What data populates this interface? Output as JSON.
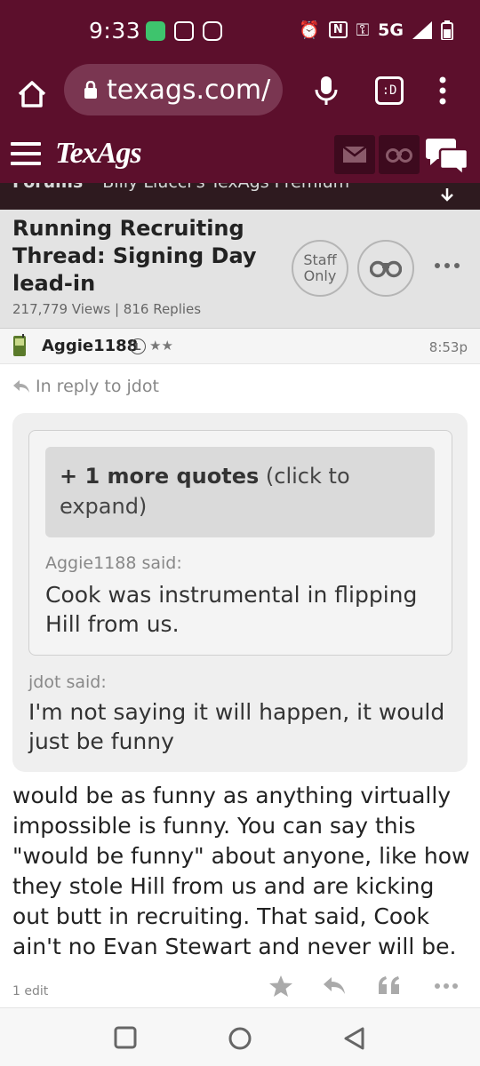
{
  "status_bar": {
    "time": "9:33",
    "network": "5G"
  },
  "browser": {
    "url": "texags.com/",
    "tab_label": ":D"
  },
  "site": {
    "logo": "TexAgs"
  },
  "breadcrumb": {
    "section": "Forums",
    "board": "Billy Liucci's TexAgs Premium"
  },
  "thread": {
    "title": "Running Recruiting Thread: Signing Day lead-in",
    "stats": "217,779 Views | 816 Replies",
    "staff_label_1": "Staff",
    "staff_label_2": "Only"
  },
  "post": {
    "author": "Aggie1188",
    "badge": "L",
    "stars": "★★",
    "time": "8:53p",
    "reply_to": "In reply to jdot",
    "more_quotes_bold": "+ 1 more quotes",
    "more_quotes_rest": " (click to expand)",
    "inner_said": "Aggie1188 said:",
    "inner_quote": "Cook was instrumental in flipping Hill from us.",
    "outer_said": "jdot said:",
    "outer_quote": "I'm not saying it will happen, it would just be funny",
    "body": "would be as funny as anything virtually impossible is funny. You can say this \"would be funny\" about anyone, like how they stole Hill from us and are kicking out butt in recruiting. That said, Cook ain't no Evan Stewart and never will be.",
    "edit_label": "1 edit"
  },
  "colors": {
    "brand": "#5c0f2c",
    "breadcrumb": "#2e1a1f",
    "header_bg": "#e3e3e3"
  }
}
